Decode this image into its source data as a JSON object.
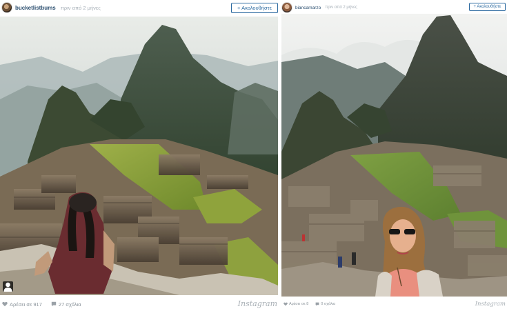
{
  "left_post": {
    "username": "bucketlistbums",
    "timestamp": "πριν από 2 μήνες",
    "follow_label": "+ Ακολουθήστε",
    "likes_text": "Αρέσει σε 917",
    "comments_text": "27 σχόλια",
    "wordmark": "Instagram",
    "icons": {
      "like": "heart-icon",
      "comment": "speech-bubble-icon",
      "tag": "person-tag-icon"
    }
  },
  "right_post": {
    "username": "biancamarzo",
    "timestamp": "πριν από 2 μήνες",
    "follow_label": "+ Ακολουθήστε",
    "likes_text": "Αρέσει σε 8",
    "comments_text": "0 σχόλια",
    "wordmark": "Instagram",
    "icons": {
      "like": "heart-icon",
      "comment": "speech-bubble-icon"
    }
  },
  "colors": {
    "username": "#2c4f70",
    "follow_border": "#2c6aa0",
    "muted_text": "#8b949b",
    "background": "#ffffff"
  }
}
